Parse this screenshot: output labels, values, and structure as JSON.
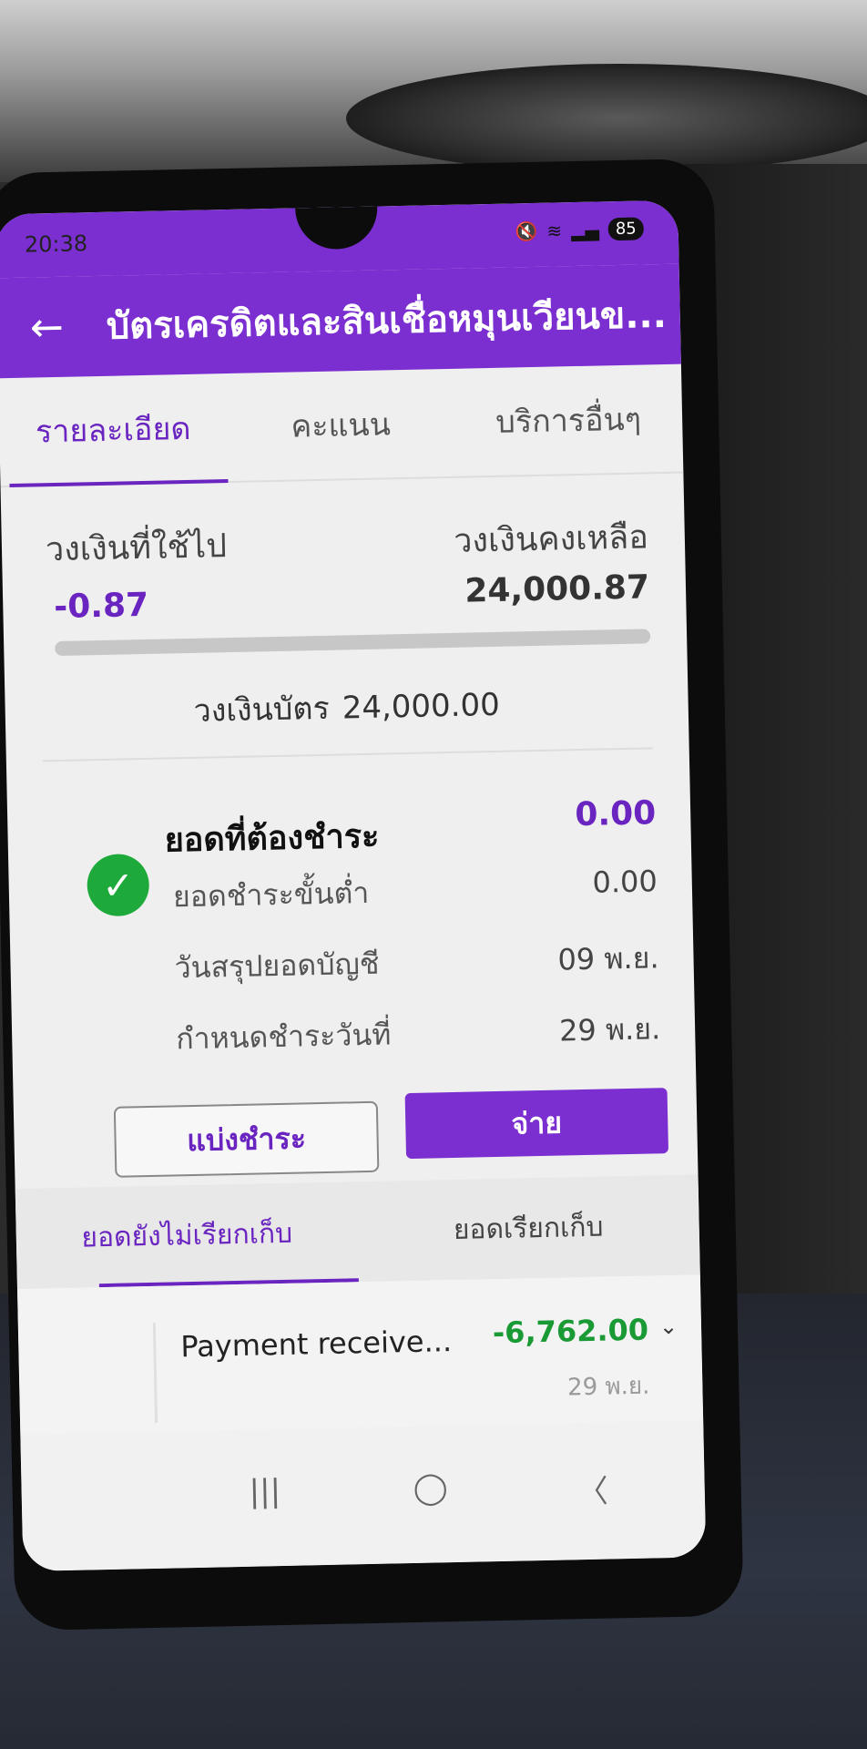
{
  "status_bar": {
    "time": "20:38",
    "battery": "85"
  },
  "app_bar": {
    "title": "บัตรเครดิตและสินเชื่อหมุนเวียนข..."
  },
  "tabs": [
    {
      "label": "รายละเอียด",
      "active": true
    },
    {
      "label": "คะแนน",
      "active": false
    },
    {
      "label": "บริการอื่นๆ",
      "active": false
    }
  ],
  "credit": {
    "used_label": "วงเงินที่ใช้ไป",
    "used_value": "-0.87",
    "remaining_label": "วงเงินคงเหลือ",
    "remaining_value": "24,000.87",
    "limit_label": "วงเงินบัตร",
    "limit_value": "24,000.00",
    "used_fraction": 0
  },
  "payment_due": {
    "title": "ยอดที่ต้องชำระ",
    "amount": "0.00",
    "rows": [
      {
        "label": "ยอดชำระขั้นต่ำ",
        "value": "0.00"
      },
      {
        "label": "วันสรุปยอดบัญชี",
        "value": "09 พ.ย."
      },
      {
        "label": "กำหนดชำระวันที่",
        "value": "29 พ.ย."
      }
    ]
  },
  "buttons": {
    "split_label": "แบ่งชำระ",
    "pay_label": "จ่าย"
  },
  "transaction_tabs": [
    {
      "label": "ยอดยังไม่เรียกเก็บ",
      "active": true
    },
    {
      "label": "ยอดเรียกเก็บ",
      "active": false
    }
  ],
  "transactions": [
    {
      "description": "Payment receive...",
      "amount": "-6,762.00",
      "date": "29 พ.ย."
    }
  ],
  "colors": {
    "primary": "#7b2fd0",
    "success": "#1eaa3a",
    "positive_amount": "#1a9a35"
  },
  "icons": {
    "back": "arrow-left-icon",
    "check": "check-circle-icon",
    "expand": "chevron-down-icon"
  }
}
